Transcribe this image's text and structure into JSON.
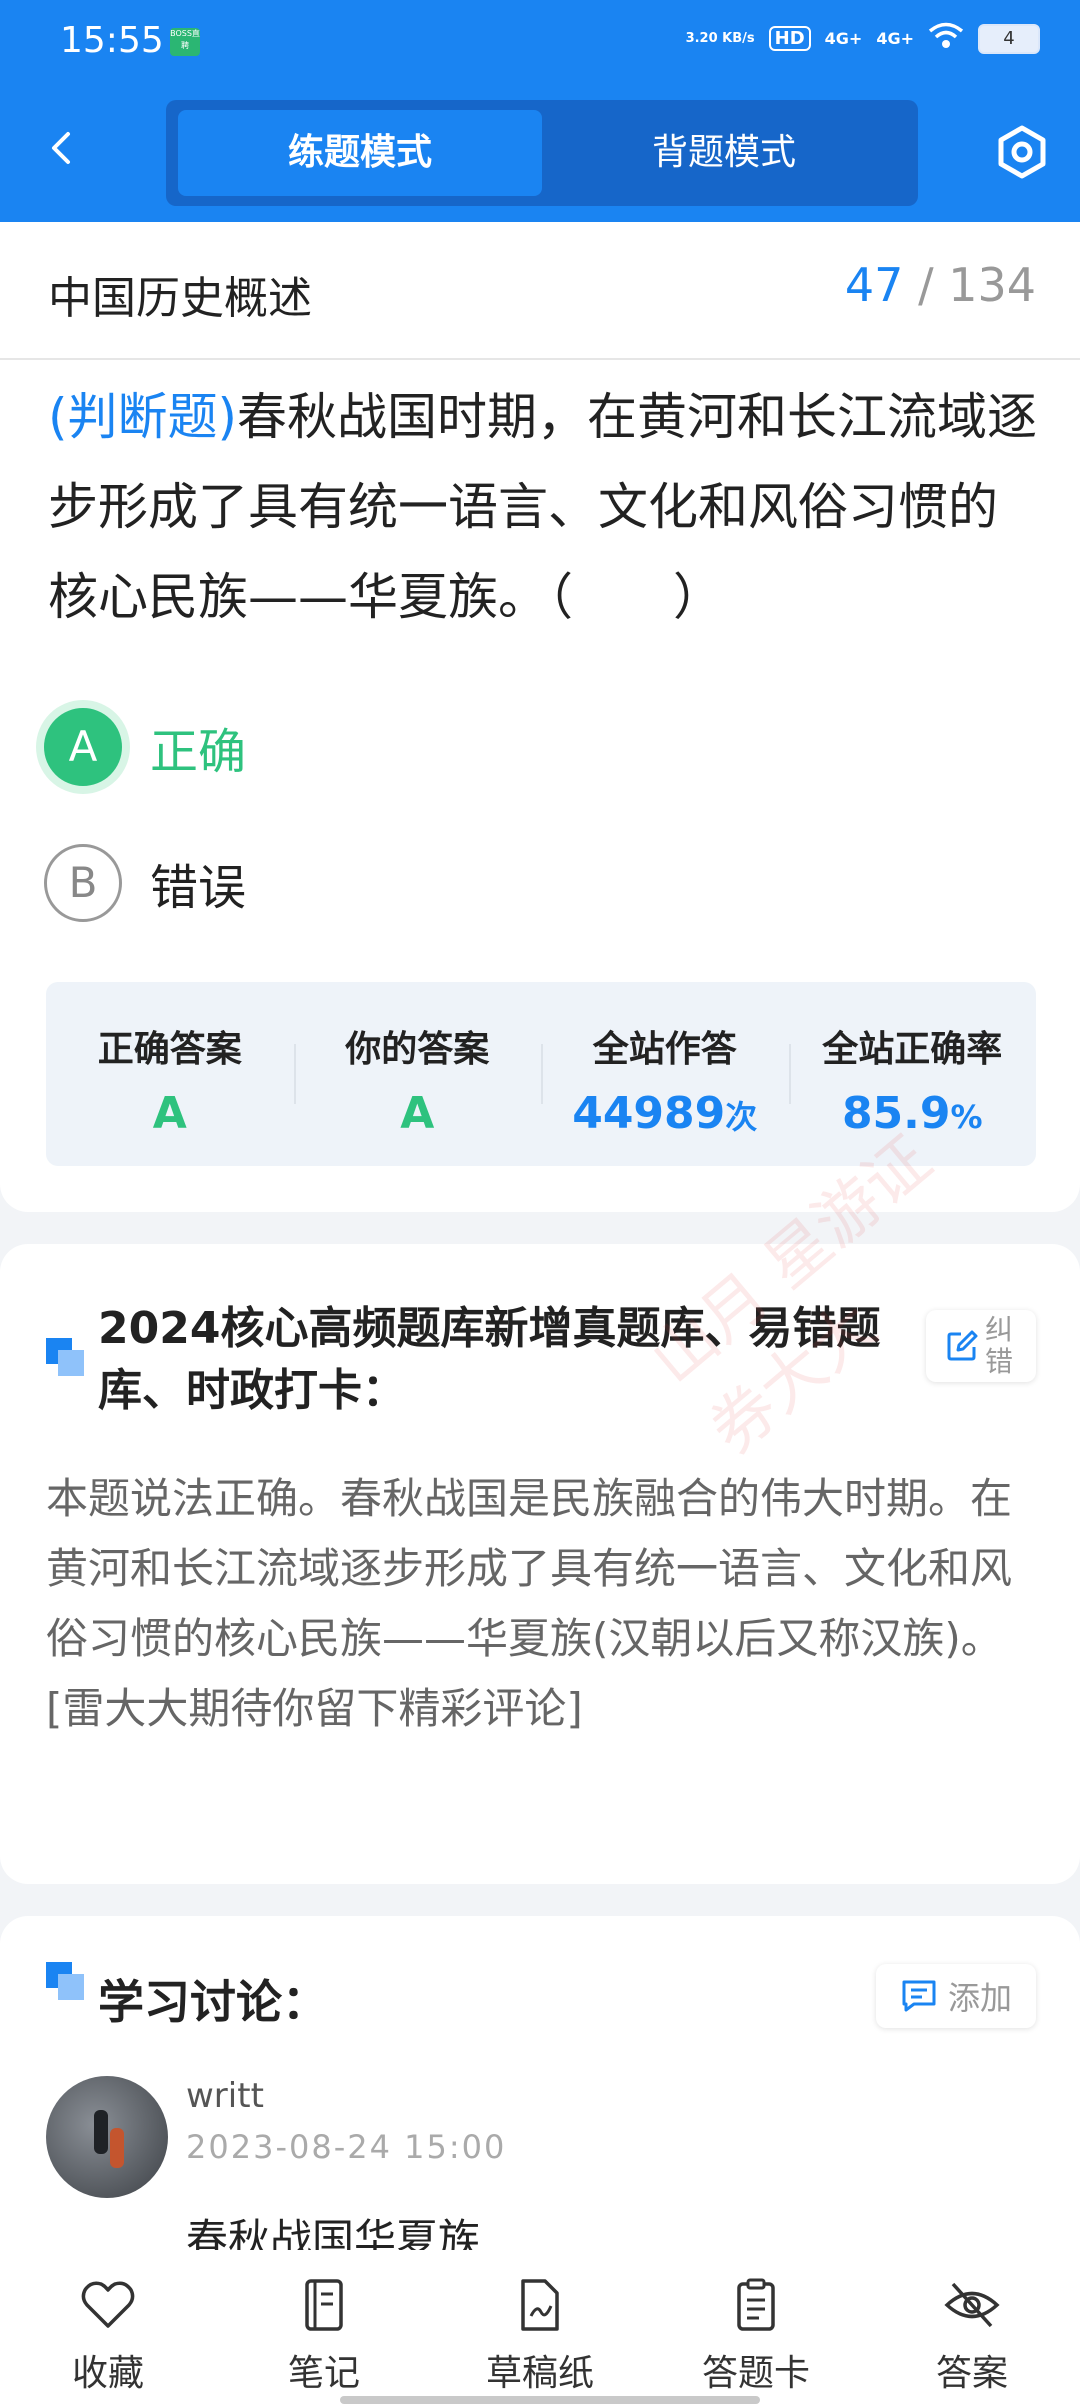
{
  "status": {
    "time": "15:55",
    "app_badge": "BOSS直聘",
    "net_speed": "3.20 KB/s",
    "hd": "HD",
    "signal1": "4G+",
    "signal2": "4G+",
    "battery": "4"
  },
  "header": {
    "tabs": [
      {
        "label": "练题模式",
        "active": true
      },
      {
        "label": "背题模式",
        "active": false
      }
    ]
  },
  "question_card": {
    "subject": "中国历史概述",
    "current": "47",
    "separator": "/",
    "total": "134",
    "type_label": "(判断题)",
    "text": "春秋战国时期，在黄河和长江流域逐步形成了具有统一语言、文化和风俗习惯的核心民族——华夏族。（　　）",
    "options": [
      {
        "letter": "A",
        "label": "正确",
        "selected": true
      },
      {
        "letter": "B",
        "label": "错误",
        "selected": false
      }
    ],
    "stats": [
      {
        "title": "正确答案",
        "value": "A",
        "unit": ""
      },
      {
        "title": "你的答案",
        "value": "A",
        "unit": ""
      },
      {
        "title": "全站作答",
        "value": "44989",
        "unit": "次"
      },
      {
        "title": "全站正确率",
        "value": "85.9",
        "unit": "%"
      }
    ]
  },
  "analysis": {
    "title": "2024核心高频题库新增真题库、易错题库、时政打卡：",
    "fix_label": "纠错",
    "text": "本题说法正确。春秋战国是民族融合的伟大时期。在黄河和长江流域逐步形成了具有统一语言、文化和风俗习惯的核心民族——华夏族(汉朝以后又称汉族)。",
    "note": "[雷大大期待你留下精彩评论]"
  },
  "discussion": {
    "title": "学习讨论：",
    "add_label": "添加",
    "comments": [
      {
        "user": "writt",
        "date": "2023-08-24 15:00",
        "text": "春秋战国华夏族"
      }
    ]
  },
  "bottom_nav": [
    {
      "label": "收藏",
      "icon": "heart-icon"
    },
    {
      "label": "笔记",
      "icon": "notebook-icon"
    },
    {
      "label": "草稿纸",
      "icon": "draft-icon"
    },
    {
      "label": "答题卡",
      "icon": "clipboard-icon"
    },
    {
      "label": "答案",
      "icon": "eye-off-icon"
    }
  ],
  "watermark": "山月 星游证券大大",
  "colors": {
    "primary": "#1a84f2",
    "correct": "#2ec27e"
  }
}
